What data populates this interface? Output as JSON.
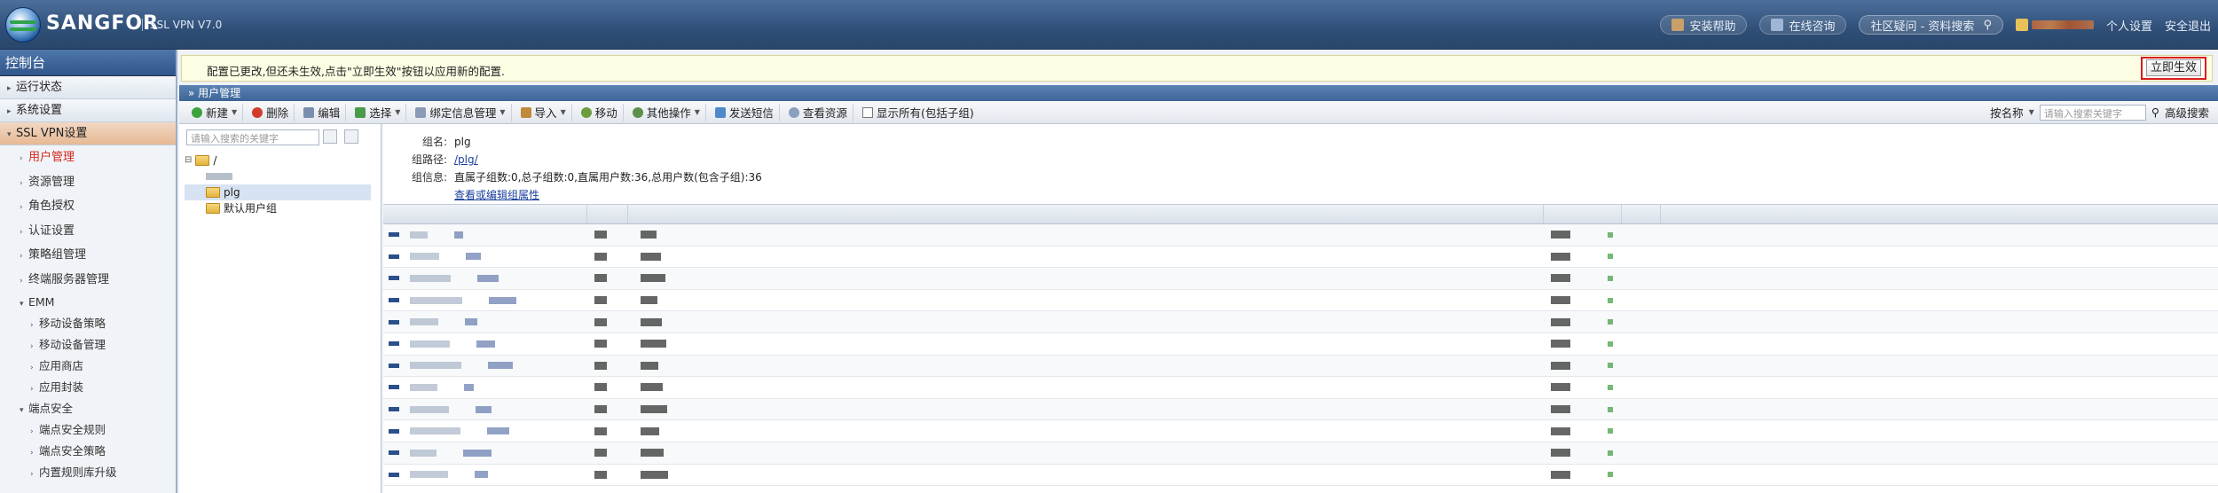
{
  "header": {
    "brand": "SANGFOR",
    "product": "SSL VPN V7.0",
    "links": {
      "security": "安装帮助",
      "online": "在线咨询",
      "community": "社区疑问 - 资料搜索",
      "personal": "个人设置",
      "logout": "安全退出"
    }
  },
  "sidebar": {
    "title": "控制台",
    "sections": [
      {
        "label": "运行状态"
      },
      {
        "label": "系统设置"
      },
      {
        "label": "SSL VPN设置"
      }
    ],
    "items": [
      {
        "label": "用户管理"
      },
      {
        "label": "资源管理"
      },
      {
        "label": "角色授权"
      },
      {
        "label": "认证设置"
      },
      {
        "label": "策略组管理"
      },
      {
        "label": "终端服务器管理"
      }
    ],
    "emm": {
      "label": "EMM",
      "children": [
        "移动设备策略",
        "移动设备管理",
        "应用商店",
        "应用封装"
      ]
    },
    "endpoint": {
      "label": "端点安全",
      "children": [
        "端点安全规则",
        "端点安全策略",
        "内置规则库升级"
      ]
    }
  },
  "notice": {
    "text": "配置已更改,但还未生效,点击\"立即生效\"按钮以应用新的配置.",
    "apply_label": "立即生效"
  },
  "panel": {
    "title": "用户管理"
  },
  "toolbar": {
    "new": "新建",
    "delete": "删除",
    "edit": "编辑",
    "select": "选择",
    "bind": "绑定信息管理",
    "import": "导入",
    "move": "移动",
    "other": "其他操作",
    "sms": "发送短信",
    "view_res": "查看资源",
    "show_all": "显示所有(包括子组)",
    "search_by": "按名称",
    "search_placeholder": "请输入搜索关键字",
    "advanced": "高级搜索"
  },
  "tree": {
    "search_placeholder": "请输入搜索的关键字",
    "root": "/",
    "nodes": [
      "plg",
      "默认用户组"
    ]
  },
  "group_info": {
    "name_label": "组名:",
    "name": "plg",
    "path_label": "组路径:",
    "path": "/plg/",
    "info_label": "组信息:",
    "info": "直属子组数:0,总子组数:0,直属用户数:36,总用户数(包含子组):36",
    "view_link": "查看或编辑组属性"
  },
  "colors": {
    "accent": "#2f4f78",
    "highlight": "#d91d1d",
    "notice_bg": "#fdfde4"
  },
  "icons": [
    "logo-globe-icon",
    "help-icon",
    "chat-icon",
    "search-icon",
    "user-icon",
    "folder-icon"
  ]
}
